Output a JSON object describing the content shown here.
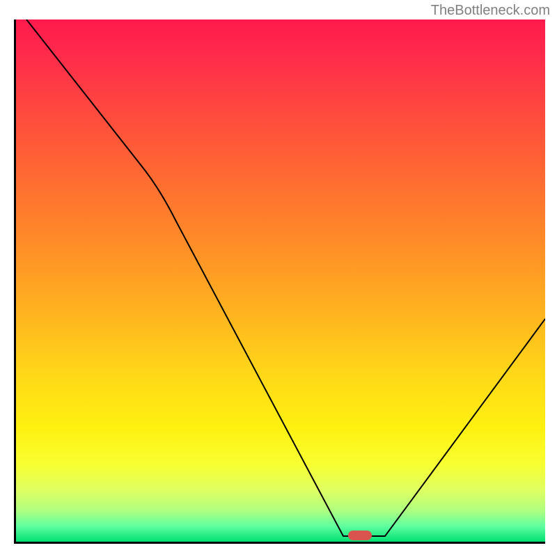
{
  "attribution": "TheBottleneck.com",
  "chart_data": {
    "type": "line",
    "title": "",
    "xlabel": "",
    "ylabel": "",
    "xlim": [
      0,
      100
    ],
    "ylim": [
      0,
      100
    ],
    "series": [
      {
        "name": "curve",
        "x": [
          2,
          24,
          62,
          70,
          100
        ],
        "y": [
          100,
          72,
          1,
          1,
          43
        ]
      }
    ],
    "marker": {
      "x": 65,
      "y": 1
    },
    "background_gradient": {
      "top": "#ff1a4d",
      "middle": "#ffd818",
      "bottom": "#00e070"
    }
  }
}
